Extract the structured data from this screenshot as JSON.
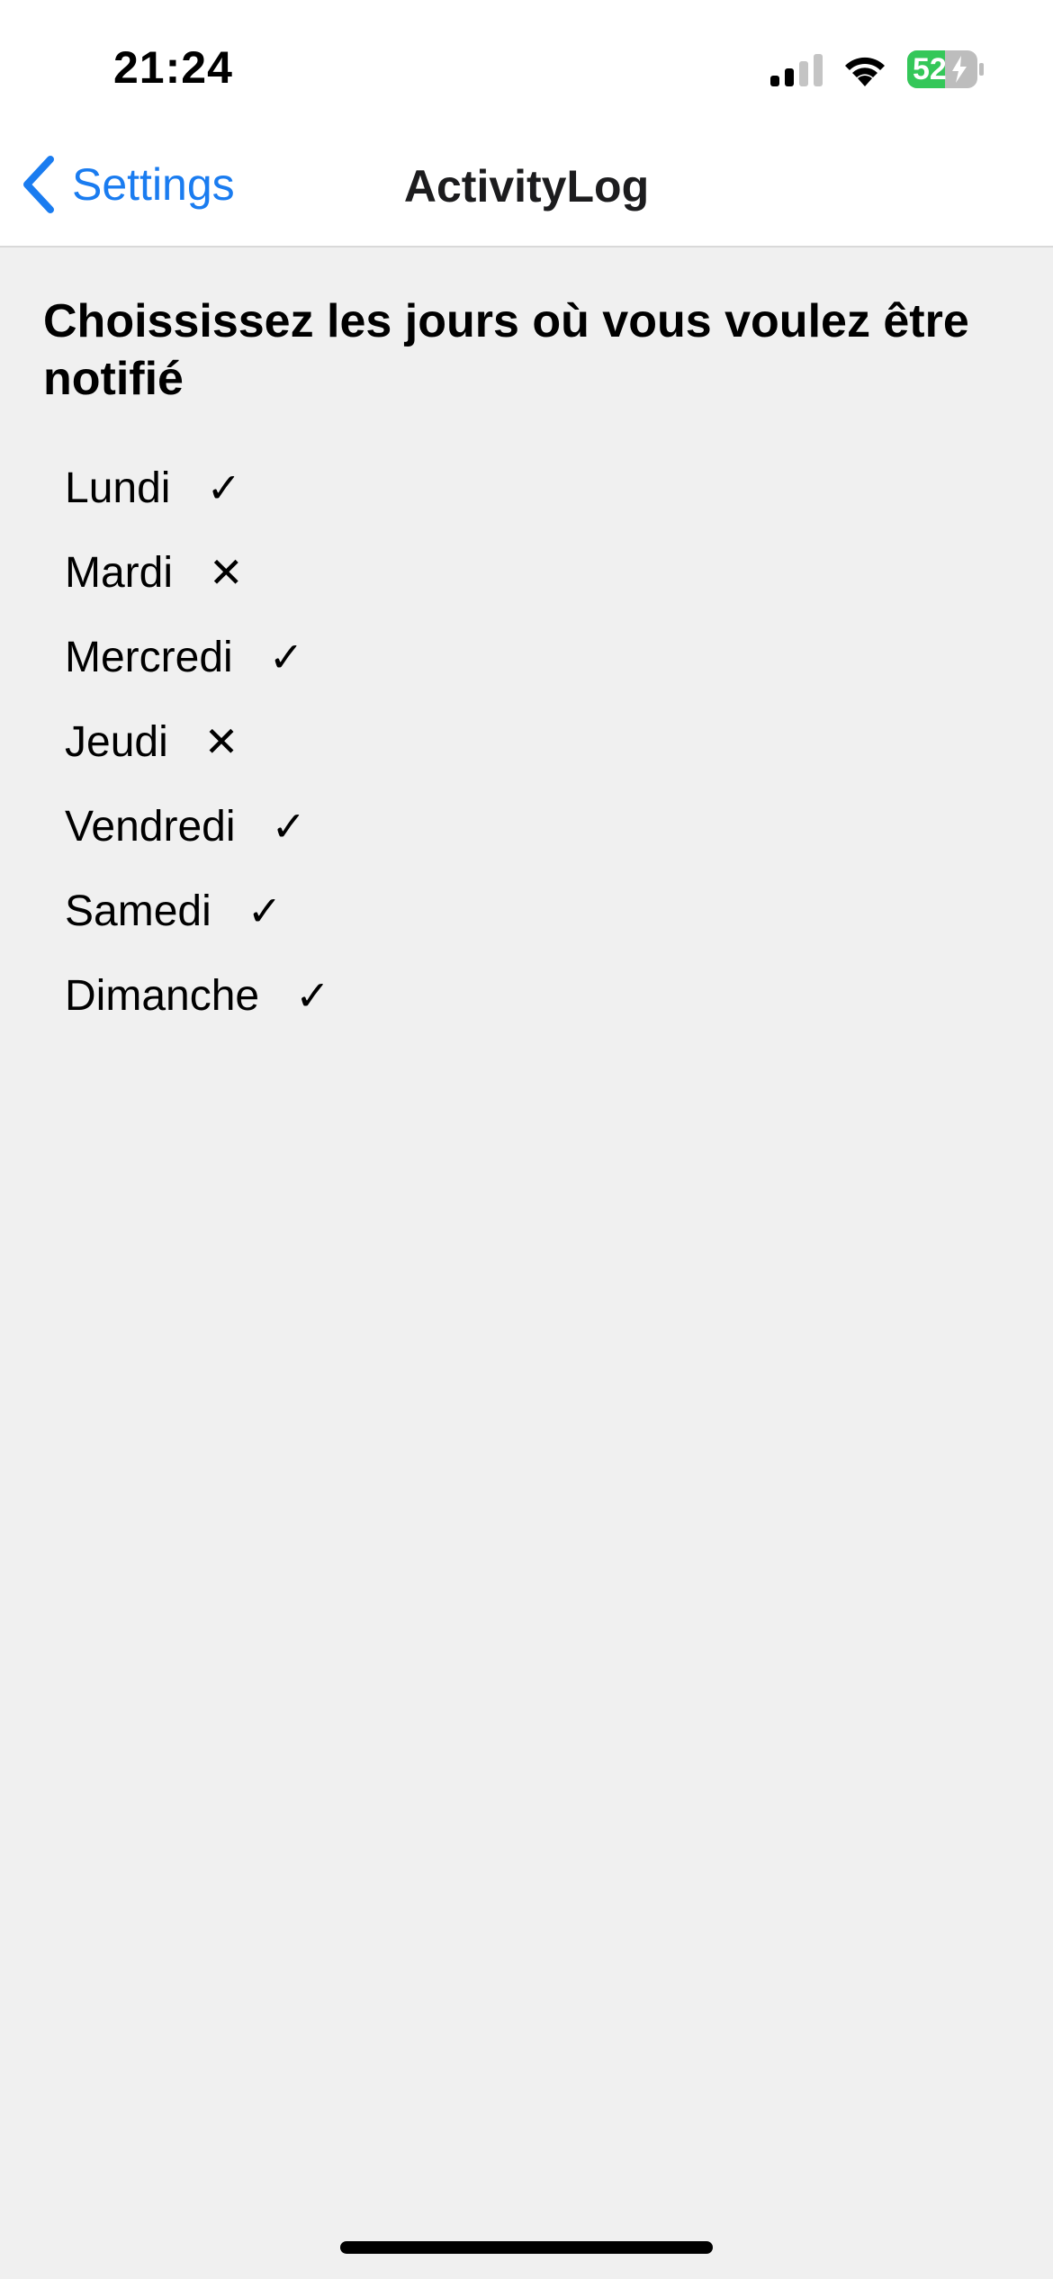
{
  "status_bar": {
    "time": "21:24",
    "battery_level": "52",
    "icons": [
      "signal-icon",
      "wifi-icon",
      "battery-charging-icon"
    ],
    "battery_color": "#34c759"
  },
  "nav": {
    "back_label": "Settings",
    "back_icon": "chevron-left-icon",
    "title": "ActivityLog",
    "accent_color": "#1a7cf0"
  },
  "main": {
    "heading": "Choississez les jours où vous voulez être notifié",
    "days": [
      {
        "label": "Lundi",
        "mark": "✓",
        "enabled": true
      },
      {
        "label": "Mardi",
        "mark": "✕",
        "enabled": false
      },
      {
        "label": "Mercredi",
        "mark": "✓",
        "enabled": true
      },
      {
        "label": "Jeudi",
        "mark": "✕",
        "enabled": false
      },
      {
        "label": "Vendredi",
        "mark": "✓",
        "enabled": true
      },
      {
        "label": "Samedi",
        "mark": "✓",
        "enabled": true
      },
      {
        "label": "Dimanche",
        "mark": "✓",
        "enabled": true
      }
    ]
  }
}
